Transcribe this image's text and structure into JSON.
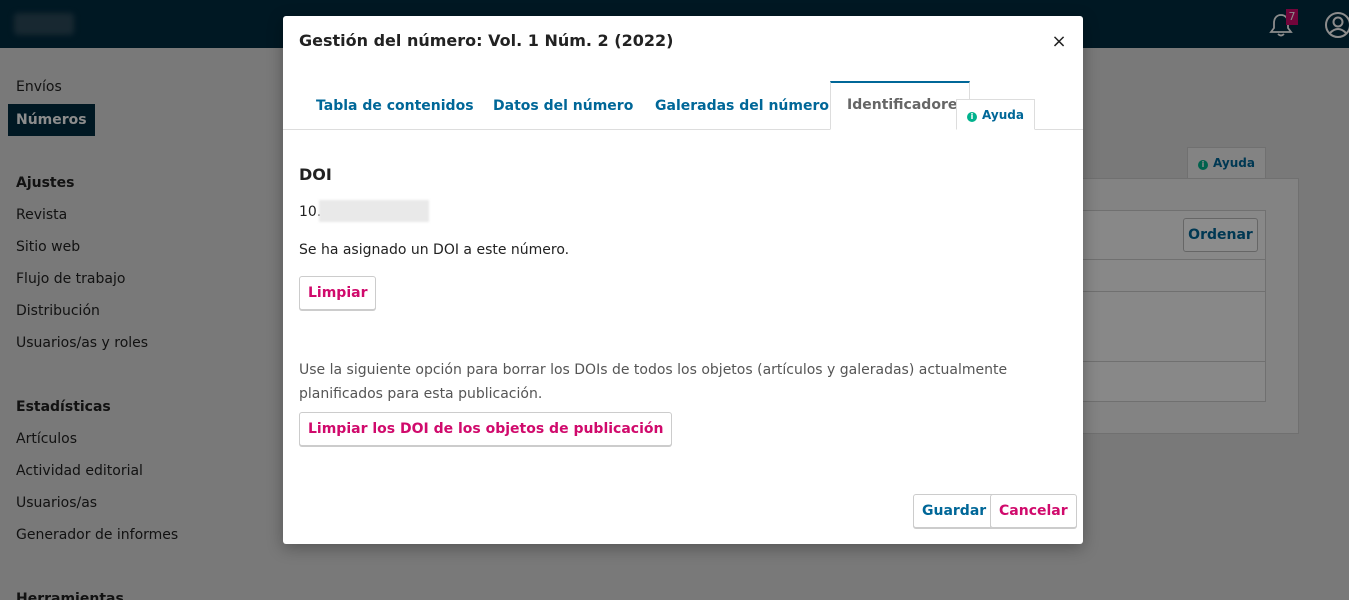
{
  "header": {
    "notification_count": "7"
  },
  "sidebar": {
    "submissions": "Envíos",
    "issues": "Números",
    "settings_heading": "Ajustes",
    "settings_items": [
      "Revista",
      "Sitio web",
      "Flujo de trabajo",
      "Distribución",
      "Usuarios/as y roles"
    ],
    "stats_heading": "Estadísticas",
    "stats_items": [
      "Artículos",
      "Actividad editorial",
      "Usuarios/as",
      "Generador de informes"
    ],
    "tools_heading": "Herramientas"
  },
  "background": {
    "help_label": "Ayuda",
    "sort_label": "Ordenar"
  },
  "modal": {
    "title": "Gestión del número: Vol. 1 Núm. 2 (2022)",
    "close_symbol": "×",
    "tabs": [
      "Tabla de contenidos",
      "Datos del número",
      "Galeradas del número",
      "Identificadores"
    ],
    "help_label": "Ayuda",
    "doi_title": "DOI",
    "doi_prefix": "10.",
    "doi_status": "Se ha asignado un DOI a este número.",
    "clear_label": "Limpiar",
    "description": "Use la siguiente opción para borrar los DOIs de todos los objetos (artículos y galeradas) actualmente planificados para esta publicación.",
    "clear_objects_label": "Limpiar los DOI de los objetos de publicación",
    "save_label": "Guardar",
    "cancel_label": "Cancelar"
  },
  "colors": {
    "navy": "#002c40",
    "link_blue": "#006798",
    "accent_pink": "#d00a6c",
    "help_green": "#00b28d"
  }
}
